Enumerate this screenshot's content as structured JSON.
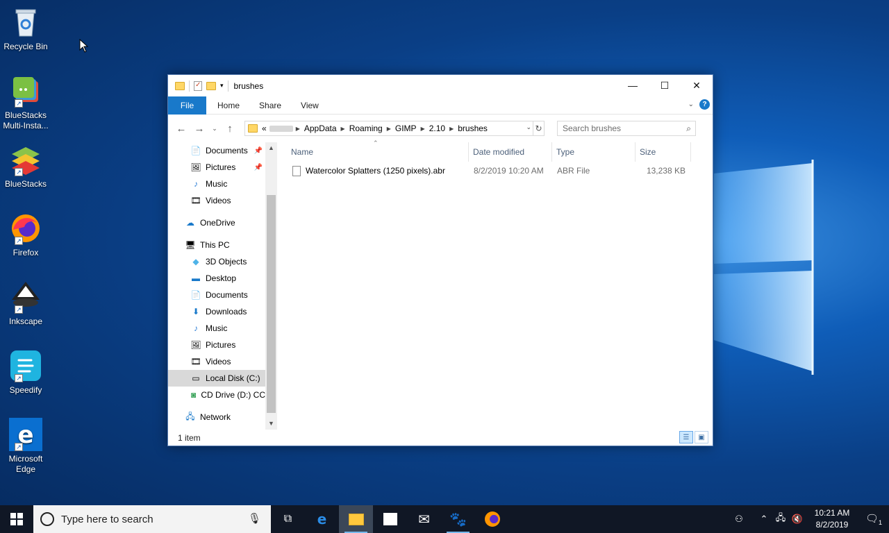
{
  "desktop": {
    "icons": [
      {
        "label": "Recycle Bin"
      },
      {
        "label": "BlueStacks Multi-Insta..."
      },
      {
        "label": "BlueStacks"
      },
      {
        "label": "Firefox"
      },
      {
        "label": "Inkscape"
      },
      {
        "label": "Speedify"
      },
      {
        "label": "Microsoft Edge"
      }
    ]
  },
  "window": {
    "title": "brushes",
    "ribbon_tabs": [
      "File",
      "Home",
      "Share",
      "View"
    ],
    "address": {
      "prefix": "«",
      "crumbs": [
        "AppData",
        "Roaming",
        "GIMP",
        "2.10",
        "brushes"
      ]
    },
    "search_placeholder": "Search brushes",
    "nav_items": {
      "documents_quick": "Documents",
      "pictures_quick": "Pictures",
      "music_quick": "Music",
      "videos_quick": "Videos",
      "onedrive": "OneDrive",
      "this_pc": "This PC",
      "objects3d": "3D Objects",
      "desktop": "Desktop",
      "documents": "Documents",
      "downloads": "Downloads",
      "music": "Music",
      "pictures": "Pictures",
      "videos": "Videos",
      "local_disk": "Local Disk (C:)",
      "cd_drive": "CD Drive (D:) CC",
      "network": "Network"
    },
    "columns": {
      "name": "Name",
      "date": "Date modified",
      "type": "Type",
      "size": "Size"
    },
    "files": [
      {
        "name": "Watercolor Splatters (1250 pixels).abr",
        "date": "8/2/2019 10:20 AM",
        "type": "ABR File",
        "size": "13,238 KB"
      }
    ],
    "status": "1 item"
  },
  "taskbar": {
    "search_placeholder": "Type here to search",
    "time": "10:21 AM",
    "date": "8/2/2019",
    "notification_count": "1"
  },
  "colors": {
    "accent": "#1979ca",
    "taskbar": "#101725",
    "desktop_blue": "#0f5db8"
  }
}
